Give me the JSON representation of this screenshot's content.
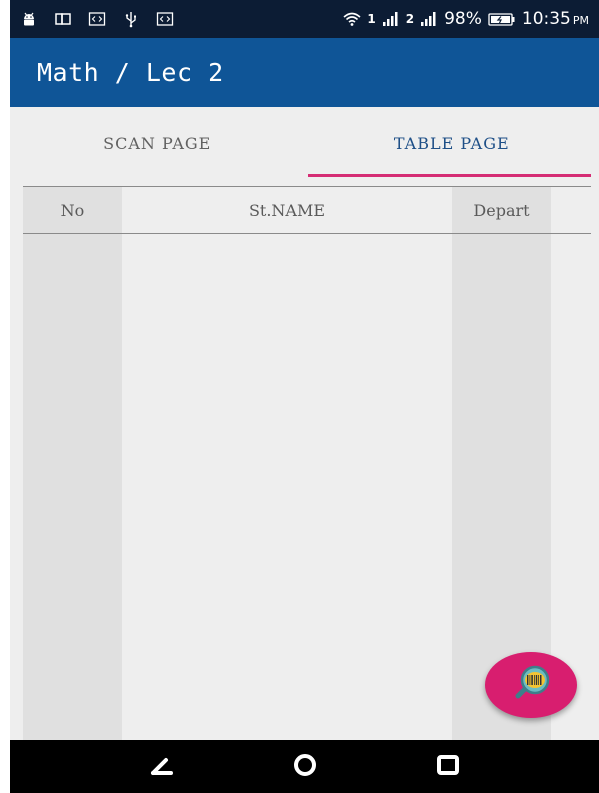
{
  "status_bar": {
    "signal1_label": "1",
    "signal2_label": "2",
    "battery_percent": "98%",
    "time": "10:35",
    "time_suffix": "PM",
    "icons": [
      "android-icon",
      "screen-mirror-icon",
      "code-icon",
      "usb-icon",
      "code-icon",
      "wifi-icon",
      "signal-icon",
      "battery-charging-icon"
    ]
  },
  "app_bar": {
    "title": "Math / Lec 2"
  },
  "tabs": [
    {
      "label": "SCAN PAGE",
      "active": false
    },
    {
      "label": "TABLE PAGE",
      "active": true
    }
  ],
  "table": {
    "columns": [
      "No",
      "St.NAME",
      "Depart"
    ],
    "rows": []
  },
  "fab": {
    "icon": "barcode-search-icon"
  },
  "nav_bar": {
    "icons": [
      "back-icon",
      "home-icon",
      "recents-icon"
    ]
  },
  "colors": {
    "status_bar": "#0c1c34",
    "app_bar": "#0f5597",
    "tab_active_text": "#1e4f87",
    "tab_indicator": "#d52d74",
    "fab": "#d81e6f",
    "column_shade": "#e0e0e0",
    "background": "#eeeeee"
  }
}
